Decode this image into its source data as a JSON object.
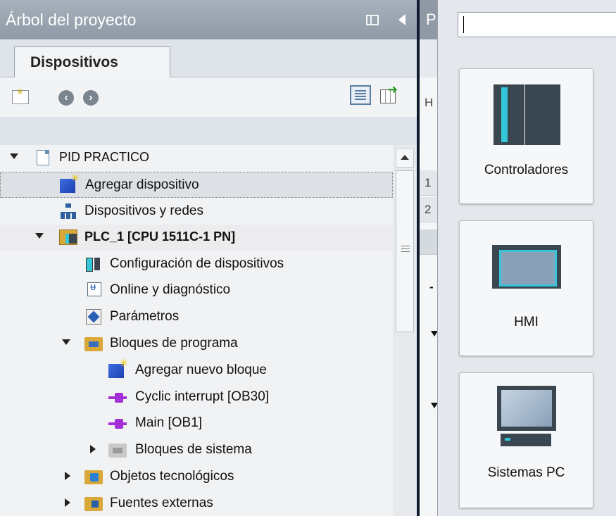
{
  "tree_panel": {
    "title": "Árbol del proyecto",
    "tab_label": "Dispositivos",
    "items": [
      {
        "label": "PID PRACTICO",
        "icon": "project-icon",
        "expander": "expanded"
      },
      {
        "label": "Agregar dispositivo",
        "icon": "add-device-icon",
        "selected": true
      },
      {
        "label": "Dispositivos y redes",
        "icon": "devices-networks-icon"
      },
      {
        "label": "PLC_1 [CPU 1511C-1 PN]",
        "icon": "plc-icon",
        "expander": "expanded",
        "bold": true
      },
      {
        "label": "Configuración de dispositivos",
        "icon": "device-config-icon"
      },
      {
        "label": "Online y diagnóstico",
        "icon": "online-diagnostics-icon"
      },
      {
        "label": "Parámetros",
        "icon": "parameters-icon"
      },
      {
        "label": "Bloques de programa",
        "icon": "program-blocks-folder-icon",
        "expander": "expanded"
      },
      {
        "label": "Agregar nuevo bloque",
        "icon": "add-block-icon"
      },
      {
        "label": "Cyclic interrupt [OB30]",
        "icon": "ob-block-icon"
      },
      {
        "label": "Main [OB1]",
        "icon": "ob-block-icon"
      },
      {
        "label": "Bloques de sistema",
        "icon": "system-blocks-folder-icon",
        "expander": "collapsed"
      },
      {
        "label": "Objetos tecnológicos",
        "icon": "technology-objects-folder-icon",
        "expander": "collapsed"
      },
      {
        "label": "Fuentes externas",
        "icon": "external-sources-folder-icon",
        "expander": "collapsed"
      }
    ]
  },
  "middle_panel": {
    "header_letter": "P",
    "toolbar_letter": "H",
    "row_numbers": [
      "1",
      "2"
    ],
    "dash": "-"
  },
  "catalog": {
    "search_value": "",
    "tiles": [
      {
        "label": "Controladores",
        "icon": "controller-icon"
      },
      {
        "label": "HMI",
        "icon": "hmi-icon"
      },
      {
        "label": "Sistemas PC",
        "icon": "pc-system-icon"
      }
    ]
  },
  "colors": {
    "header_bg": "#8e99a5",
    "accent_cyan": "#35c7d9",
    "tree_bg": "#f1f2f4",
    "divider": "#0f1a2e"
  }
}
